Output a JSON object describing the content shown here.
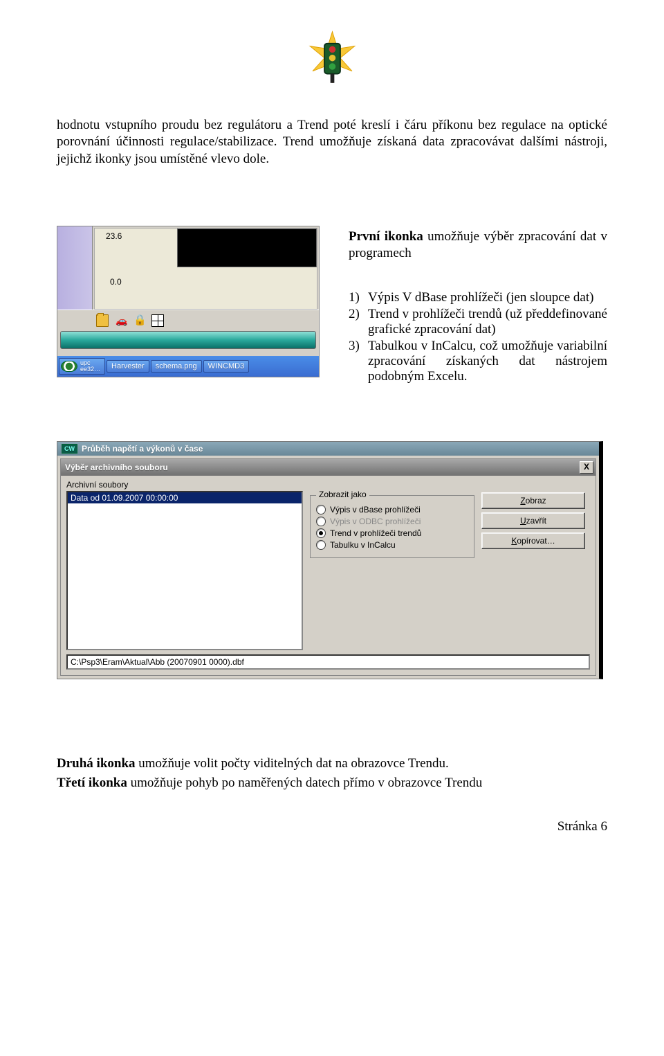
{
  "para1": "hodnotu vstupního proudu bez regulátoru a Trend poté kreslí i čáru příkonu bez regulace na optické porovnání účinnosti regulace/stabilizace. Trend umožňuje získaná data zpracovávat dalšími nástroji, jejichž ikonky jsou umístěné vlevo dole.",
  "ss1": {
    "num1": "23.6",
    "num2": "0.0",
    "task": {
      "t1a": "upc",
      "t1b": "ee32…",
      "t2": "Harvester",
      "t3": "schema.png",
      "t4": "WINCMD3"
    }
  },
  "desc1": {
    "lead": "První ikonka",
    "rest": "   umožňuje výběr zpracování dat v programech"
  },
  "list": {
    "n1": "1)",
    "t1": "Výpis V dBase prohlížeči (jen sloupce dat)",
    "n2": "2)",
    "t2": "Trend v prohlížeči trendů (už předdefinované grafické zpracování dat)",
    "n3": "3)",
    "t3": "Tabulkou v InCalcu, což umožňuje variabilní zpracování získaných dat nástrojem podobným Excelu."
  },
  "ss2": {
    "outerTitle": "Průběh napětí a výkonů v čase",
    "cw": "CW",
    "title": "Výběr archivního souboru",
    "close": "X",
    "archLabel": "Archivní soubory",
    "item": "Data od 01.09.2007 00:00:00",
    "groupTitle": "Zobrazit jako",
    "r1": "Výpis v dBase prohlížeči",
    "r2": "Výpis v ODBC prohlížeči",
    "r3": "Trend v prohlížeči trendů",
    "r4": "Tabulku v InCalcu",
    "b1": "Zobraz",
    "b2": "Uzavřít",
    "b3": "Kopírovat…",
    "path": "C:\\Psp3\\Eram\\Aktual\\Abb (20070901 0000).dbf"
  },
  "para2a_lead": "Druhá ikonka",
  "para2a_rest": " umožňuje volit počty viditelných dat na obrazovce Trendu.",
  "para2b_lead": "Třetí ikonka",
  "para2b_rest": " umožňuje pohyb po naměřených datech přímo v obrazovce Trendu",
  "footer": "Stránka 6"
}
